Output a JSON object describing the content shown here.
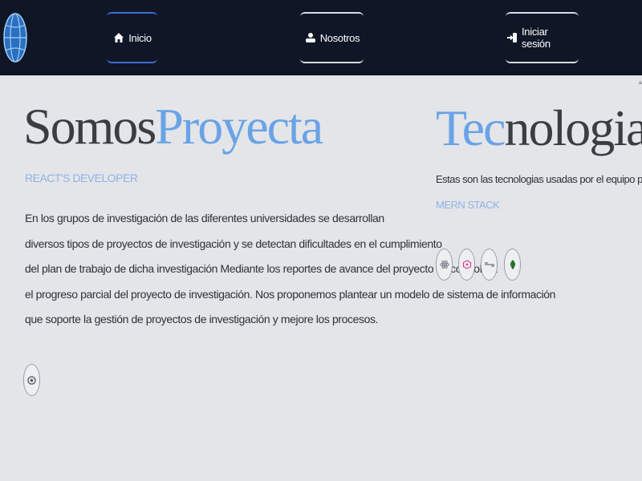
{
  "nav": {
    "logo_icon": "globe-icon",
    "items": [
      {
        "label": "Inicio",
        "icon": "home-icon",
        "active": true
      },
      {
        "label": "Nosotros",
        "icon": "team-icon",
        "active": false
      },
      {
        "label": "Iniciar sesión",
        "icon": "login-icon",
        "active": false
      }
    ]
  },
  "hero": {
    "title_prefix": "Somos",
    "title_accent": "Proyecta",
    "subtitle": "REACT'S DEVELOPER",
    "paragraph_lines": [
      "En los grupos de investigación de las diferentes universidades se desarrollan",
      "diversos tipos de proyectos de investigación y se detectan dificultades en el cumplimiento",
      "del plan de trabajo de dicha investigación Mediante los reportes de avance del proyecto se controlará",
      "el progreso parcial del proyecto de investigación. Nos proponemos plantear un modelo de sistema de información",
      "que soporte la gestión de proyectos de investigación y mejore los procesos."
    ],
    "link_icon": "github-icon"
  },
  "tech": {
    "title_accent": "Tec",
    "title_rest": "nologias",
    "description": "Estas son las tecnologias usadas por el equipo proyecta",
    "stack_label": "MERN STACK",
    "icons": [
      "react-icon",
      "graphql-icon",
      "express-icon",
      "mongodb-icon"
    ]
  },
  "colors": {
    "navbar_bg": "#0f1626",
    "page_bg": "#e4e5e9",
    "accent": "#6aa3e6",
    "active_border": "#3f6fd6"
  }
}
